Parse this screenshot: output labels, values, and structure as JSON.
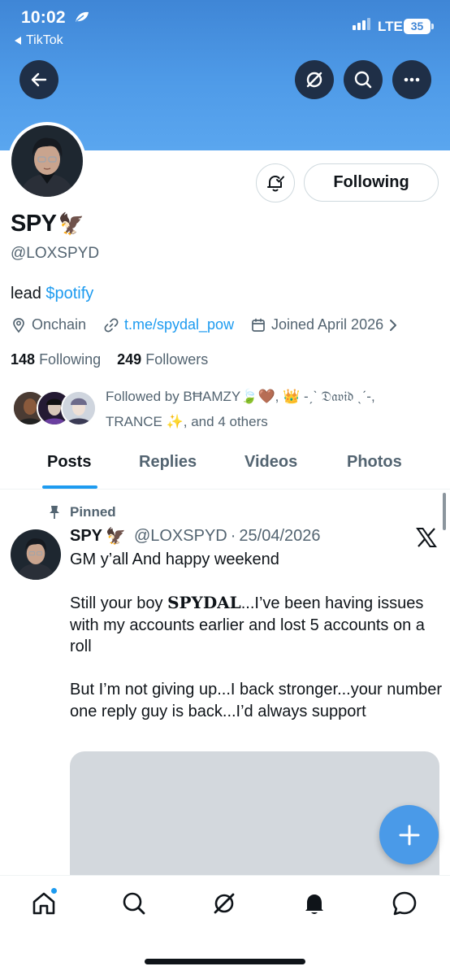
{
  "status_bar": {
    "time": "10:02",
    "back_app": "TikTok",
    "network": "LTE",
    "battery": "35"
  },
  "header": {
    "back_icon": "arrow-left-icon",
    "grok_icon": "grok-slash-circle-icon",
    "search_icon": "search-icon",
    "more_icon": "ellipsis-icon",
    "banner_color": "#4f9be8"
  },
  "profile": {
    "name": "SPY",
    "name_emoji": "🦅",
    "handle": "@LOXSPYD",
    "bio_text": "lead",
    "bio_cashtag": "$potify",
    "location": "Onchain",
    "link": "t.me/spydal_pow",
    "joined": "Joined April 2026",
    "following_count": "148",
    "following_label": "Following",
    "followers_count": "249",
    "followers_label": "Followers",
    "follow_button": "Following",
    "followed_by": "Followed by BĦAMZY🍃🤎, 👑 -ˏˋ 𝔇𝔞𝔳𝔦𝔡 ˎˊ-,",
    "followed_by_2": "TRANCE ✨, and 4 others"
  },
  "tabs": [
    {
      "label": "Posts",
      "active": true
    },
    {
      "label": "Replies",
      "active": false
    },
    {
      "label": "Videos",
      "active": false
    },
    {
      "label": "Photos",
      "active": false
    }
  ],
  "post": {
    "pinned_label": "Pinned",
    "author": "SPY",
    "author_emoji": "🦅",
    "handle": "@LOXSPYD",
    "date": "25/04/2026",
    "line1": "GM y’all And happy weekend",
    "line2_prefix": "Still your boy ",
    "line2_bold": "SPYDAL",
    "line2_rest": "...I’ve been having issues with my accounts earlier and lost 5 accounts on a roll",
    "line3": "But I’m not giving up...I back stronger...your number one reply guy is back...I’d always support"
  },
  "fab": {
    "icon": "plus-icon"
  },
  "bottom_nav": [
    {
      "icon": "home-icon"
    },
    {
      "icon": "search-icon"
    },
    {
      "icon": "grok-icon"
    },
    {
      "icon": "bell-icon"
    },
    {
      "icon": "message-icon"
    }
  ],
  "colors": {
    "accent": "#1d9bf0",
    "text": "#0f1419",
    "muted": "#536471"
  }
}
